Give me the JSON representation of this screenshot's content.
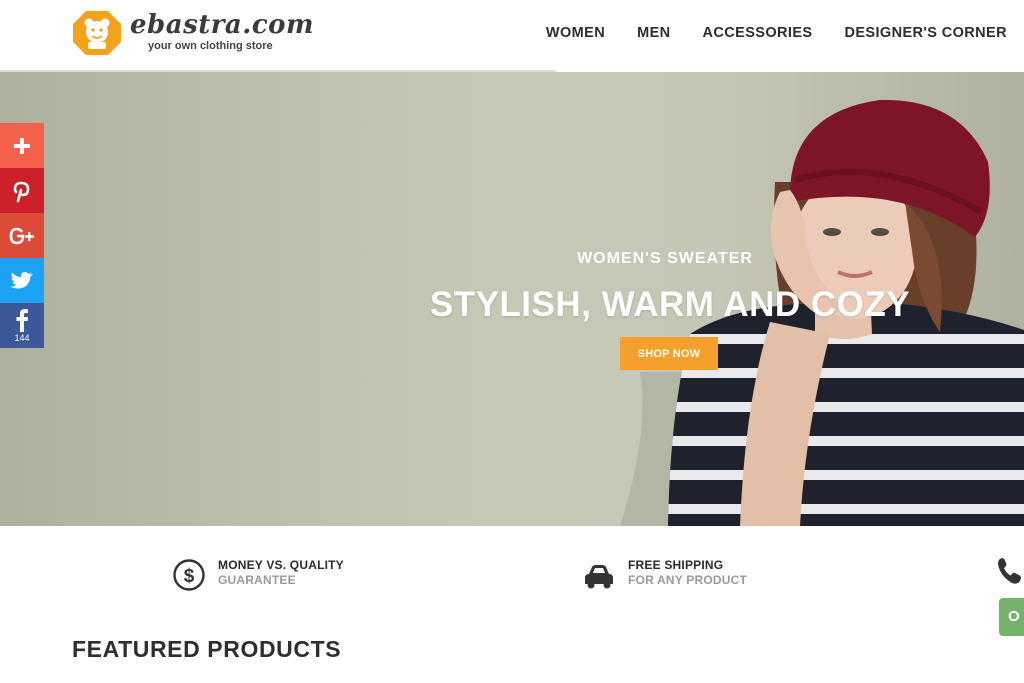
{
  "brand": {
    "name": "ebastra.com",
    "tagline": "your own clothing store",
    "logo_color": "#f4a11c"
  },
  "nav": {
    "items": [
      {
        "label": "WOMEN"
      },
      {
        "label": "MEN"
      },
      {
        "label": "ACCESSORIES"
      },
      {
        "label": "DESIGNER'S CORNER"
      }
    ]
  },
  "hero": {
    "eyebrow": "WOMEN'S SWEATER",
    "headline": "STYLISH, WARM AND COZY",
    "cta_label": "SHOP NOW",
    "cta_color": "#f5a02c"
  },
  "share": {
    "buttons": [
      {
        "icon": "plus-icon",
        "color": "#f4614a"
      },
      {
        "icon": "pinterest-icon",
        "color": "#cb2027"
      },
      {
        "icon": "google-plus-icon",
        "color": "#dd4b39"
      },
      {
        "icon": "twitter-icon",
        "color": "#1da1f2"
      },
      {
        "icon": "facebook-icon",
        "color": "#3b5998",
        "count": "144"
      }
    ]
  },
  "features": [
    {
      "icon": "dollar-icon",
      "title": "MONEY VS. QUALITY",
      "subtitle": "GUARANTEE"
    },
    {
      "icon": "car-icon",
      "title": "FREE SHIPPING",
      "subtitle": "FOR ANY PRODUCT"
    }
  ],
  "chat": {
    "label": "O",
    "color": "#75b26b"
  },
  "featured": {
    "title": "FEATURED PRODUCTS"
  }
}
